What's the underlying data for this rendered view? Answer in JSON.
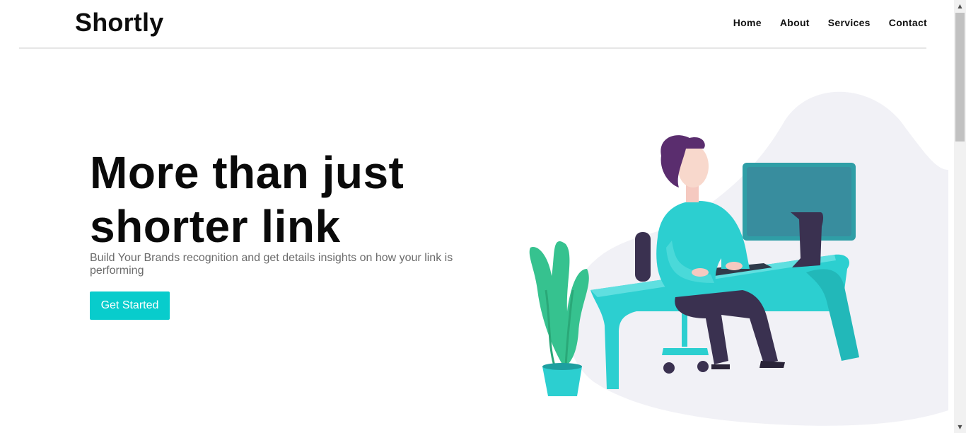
{
  "header": {
    "logo": "Shortly",
    "nav": [
      {
        "label": "Home"
      },
      {
        "label": "About"
      },
      {
        "label": "Services"
      },
      {
        "label": "Contact"
      }
    ]
  },
  "hero": {
    "title_line1": "More than just",
    "title_line2": "shorter link",
    "subtitle": "Build Your Brands recognition and get details insights on how your link is performing",
    "cta_label": "Get Started"
  },
  "colors": {
    "accent": "#08cccc",
    "teal": "#2ccfd0",
    "plant": "#36c28f",
    "hair": "#5a2d6e",
    "pants": "#3a3150",
    "blob": "#f0f0f5"
  },
  "icons": {
    "illustration": "person-at-desk-illustration",
    "scroll_up": "scroll-up-arrow-icon",
    "scroll_down": "scroll-down-arrow-icon"
  }
}
